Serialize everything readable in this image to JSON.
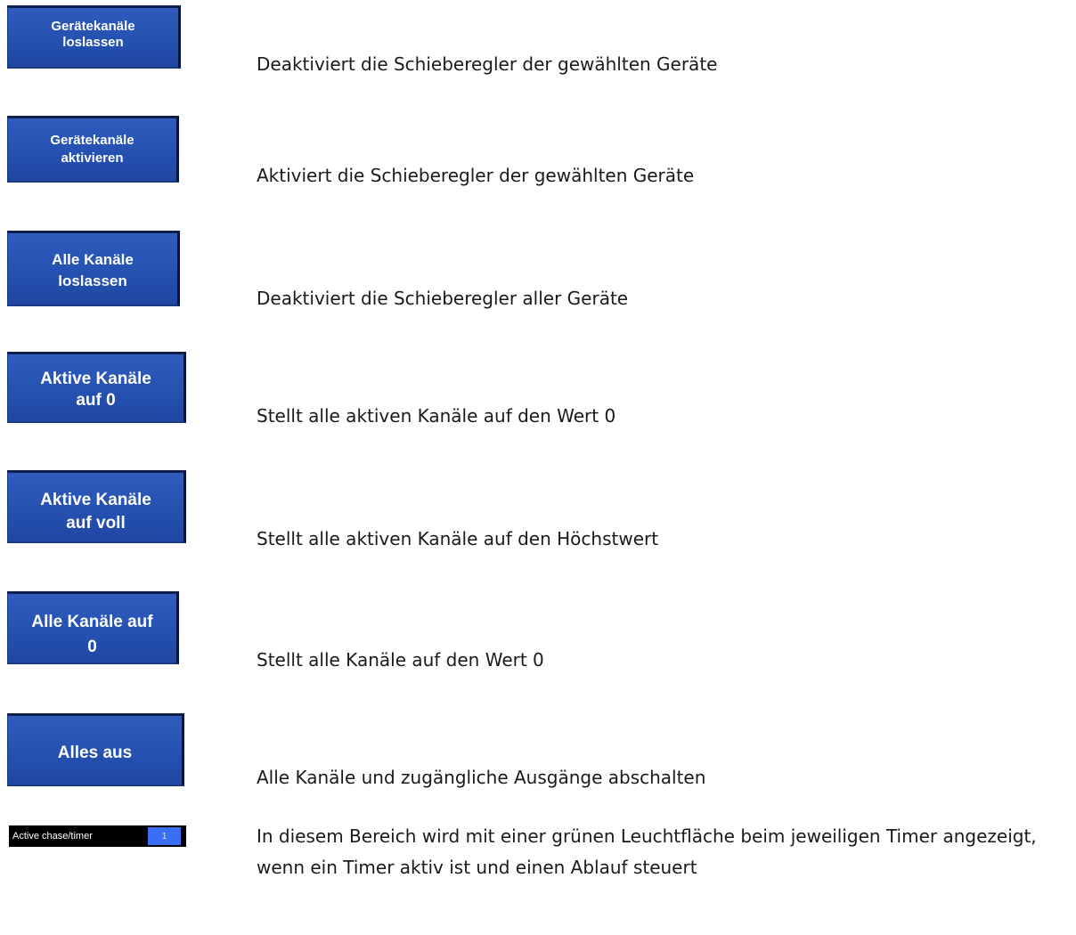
{
  "colors": {
    "button_blue": "#2753b3",
    "button_text": "#ffffff",
    "timer_bar": "#000000",
    "timer_slot": "#3a6ff5"
  },
  "items": [
    {
      "button": "Gerätekanäle\nloslassen",
      "description": "Deaktiviert die Schieberegler der gewählten Geräte"
    },
    {
      "button": "Gerätekanäle\naktivieren",
      "description": "Aktiviert die Schieberegler der gewählten Geräte"
    },
    {
      "button": "Alle Kanäle\nloslassen",
      "description": "Deaktiviert die Schieberegler aller Geräte"
    },
    {
      "button": "Aktive Kanäle\nauf 0",
      "description": "Stellt alle aktiven Kanäle auf den Wert 0"
    },
    {
      "button": "Aktive Kanäle\nauf voll",
      "description": "Stellt alle aktiven Kanäle auf den Höchstwert"
    },
    {
      "button": "Alle Kanäle auf\n0",
      "description": "Stellt alle Kanäle auf den Wert 0"
    },
    {
      "button": "Alles aus",
      "description": "Alle Kanäle und zugängliche Ausgänge abschalten"
    }
  ],
  "timer": {
    "label": "Active chase/timer",
    "slot_value": "1",
    "description": "In diesem Bereich wird mit einer grünen Leuchtfläche beim jeweiligen Timer angezeigt, wenn ein Timer aktiv ist und einen Ablauf steuert"
  }
}
